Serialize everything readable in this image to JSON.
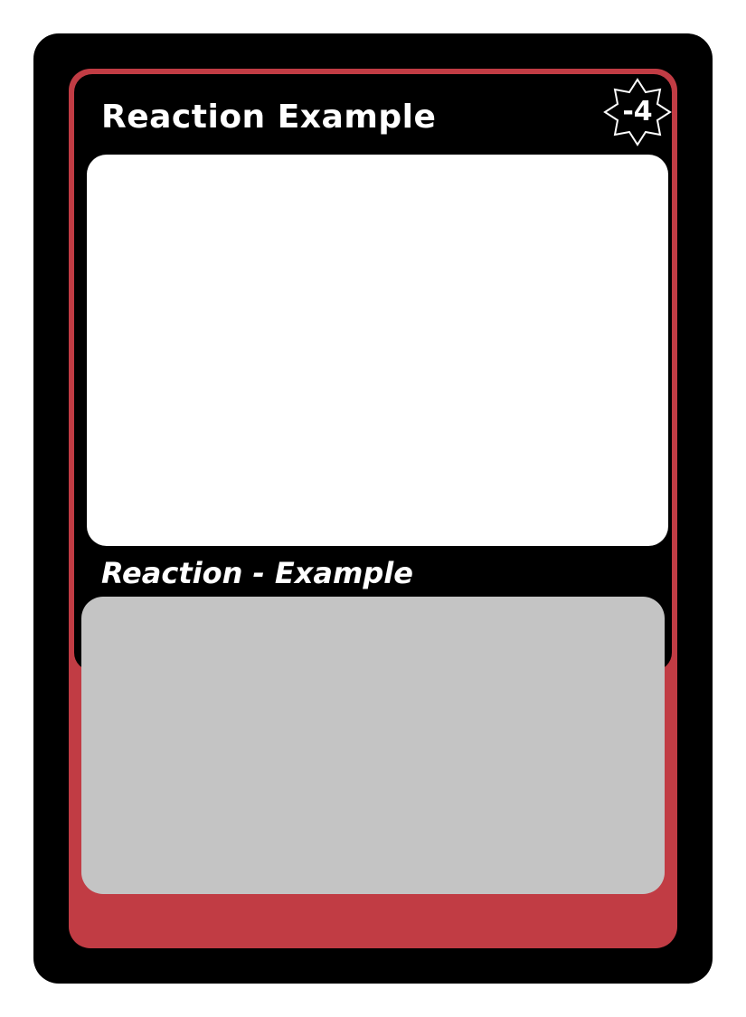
{
  "card": {
    "title": "Reaction Example",
    "cost": "-4",
    "type_line": "Reaction - Example",
    "rules_text": ""
  },
  "colors": {
    "accent": "#c13c44",
    "card_body": "#000000",
    "art_area": "#ffffff",
    "text_area": "#c4c4c4"
  },
  "icons": {
    "cost": "eight-point-star-icon"
  }
}
